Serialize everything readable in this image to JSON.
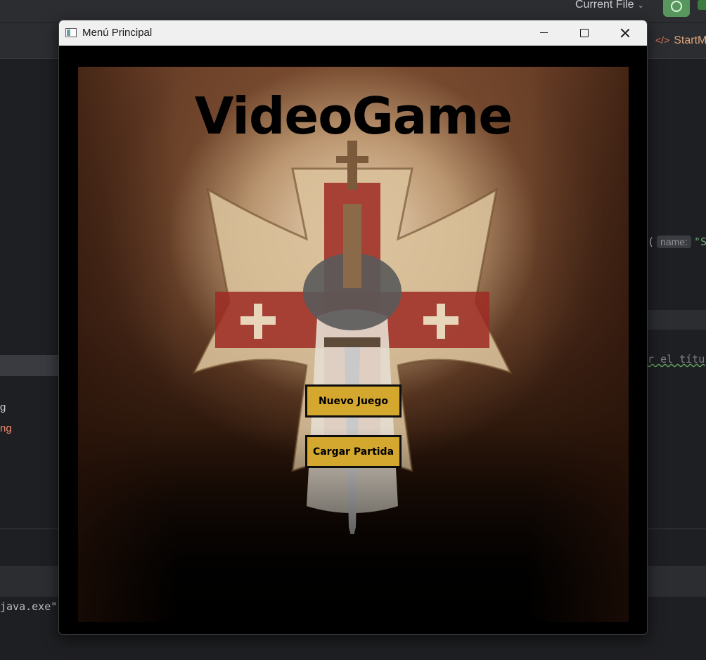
{
  "ide": {
    "run_config_label": "Current File",
    "editor_tab_label": "StartM",
    "code_hint_label": "name:",
    "code_hint_value": "\"S",
    "code_comment": "r el títu",
    "tree_item_1": "g",
    "tree_item_2": "ng",
    "console_line": "java.exe\""
  },
  "window": {
    "title": "Menú Principal",
    "minimize_icon": "minimize-icon",
    "maximize_icon": "maximize-icon",
    "close_icon": "close-icon"
  },
  "game": {
    "title": "VideoGame",
    "buttons": {
      "new_game": "Nuevo Juego",
      "load_game": "Cargar Partida"
    },
    "colors": {
      "button_fill": "#d4a82f",
      "button_border": "#0d0d0d",
      "window_background": "#000000"
    }
  }
}
